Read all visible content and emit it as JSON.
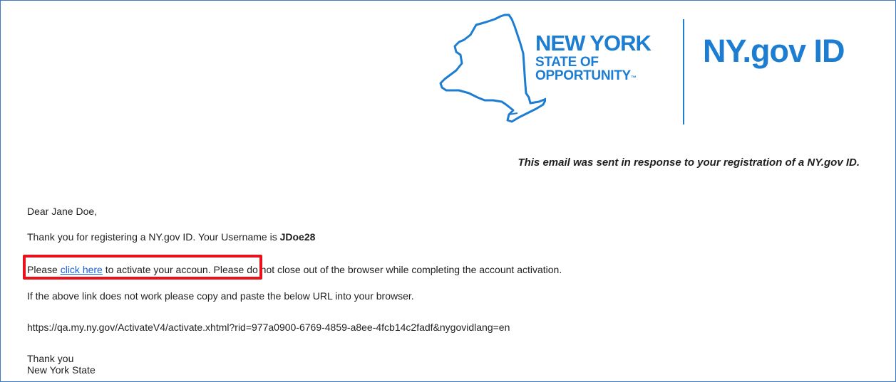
{
  "logo": {
    "line1": "NEW YORK",
    "line2": "STATE OF",
    "line3": "OPPORTUNITY",
    "tm": "™",
    "brand": "NY.gov ID"
  },
  "email": {
    "notice": "This email was sent in response to your registration of a NY.gov ID.",
    "greeting": "Dear Jane Doe,",
    "thanks_prefix": "Thank you for registering a NY.gov ID. Your Username is ",
    "username": "JDoe28",
    "activate_prefix": "Please ",
    "activate_link": "click here",
    "activate_suffix": " to activate your accoun",
    "activate_rest": ". Please do not close out of the browser while completing the account activation.",
    "fallback": "If the above link does not work please copy and paste the below URL into your browser.",
    "url": "https://qa.my.ny.gov/ActivateV4/activate.xhtml?rid=977a0900-6769-4859-a8ee-4fcb14c2fadf&nygovidlang=en",
    "closing_line1": "Thank you",
    "closing_line2": "New York State"
  },
  "colors": {
    "brand_blue": "#1d7dd1",
    "link_blue": "#1a5fd6",
    "highlight_red": "#e8121b",
    "frame_blue": "#3c78c8"
  },
  "icons": {
    "map": "new-york-state-outline-icon"
  }
}
